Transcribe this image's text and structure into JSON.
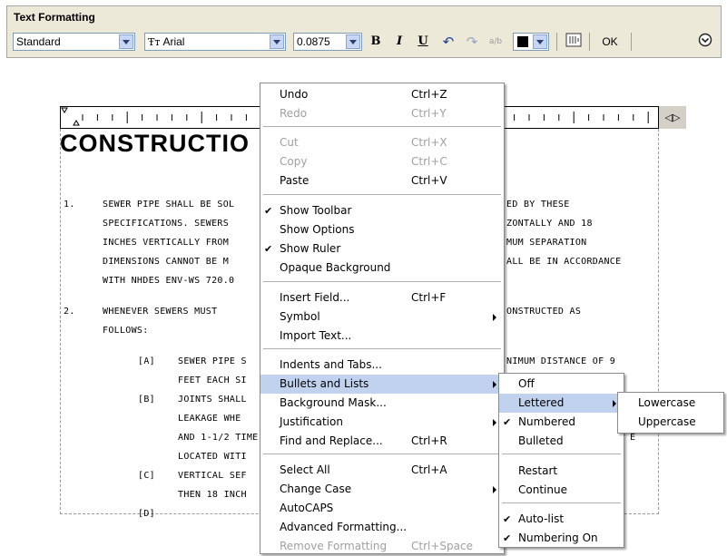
{
  "toolbar": {
    "title": "Text Formatting",
    "style_value": "Standard",
    "font_glyph": "Ŧᴛ",
    "font_value": "Arial",
    "height_value": "0.0875",
    "bold": "B",
    "italic": "I",
    "underline": "U",
    "undo_glyph": "↶",
    "redo_glyph": "↷",
    "stack_glyph": "a/b",
    "ok_label": "OK",
    "options_glyph": "⌄",
    "color_value": "#000000"
  },
  "editor": {
    "heading": "CONSTRUCTIO",
    "lines": [
      {
        "n": "1.",
        "text": "SEWER PIPE SHALL BE SOL"
      },
      {
        "text": "SPECIFICATIONS. SEWERS"
      },
      {
        "text": "INCHES VERTICALLY FROM"
      },
      {
        "text": "DIMENSIONS CANNOT BE M"
      },
      {
        "text": "WITH NHDES ENV-WS 720.0"
      },
      {
        "n": "2.",
        "text": "WHENEVER SEWERS MUST"
      },
      {
        "text": "FOLLOWS:"
      }
    ],
    "right_lines": [
      "ED BY THESE",
      "ZONTALLY AND 18",
      "MUM SEPARATION",
      "ALL BE IN ACCORDANCE",
      "",
      "ONSTRUCTED AS",
      "",
      "NIMUM DISTANCE OF 9",
      "",
      "",
      "",
      "E",
      "",
      ""
    ],
    "subs": [
      {
        "tag": "[A]",
        "text": "SEWER PIPE S"
      },
      {
        "text": "FEET EACH SI"
      },
      {
        "tag": "[B]",
        "text": "JOINTS SHALL"
      },
      {
        "text": "LEAKAGE WHE"
      },
      {
        "text": "AND 1-1/2 TIME"
      },
      {
        "text": "LOCATED WITI"
      },
      {
        "tag": "[C]",
        "text": "VERTICAL SEF"
      },
      {
        "text": "THEN 18 INCH"
      },
      {
        "tag": "[D]",
        "text": ""
      }
    ]
  },
  "context_menu": {
    "items": [
      {
        "label": "Undo",
        "shortcut": "Ctrl+Z"
      },
      {
        "label": "Redo",
        "shortcut": "Ctrl+Y",
        "disabled": true
      },
      {
        "label": "Cut",
        "shortcut": "Ctrl+X",
        "disabled": true
      },
      {
        "label": "Copy",
        "shortcut": "Ctrl+C",
        "disabled": true
      },
      {
        "label": "Paste",
        "shortcut": "Ctrl+V"
      },
      {
        "label": "Show Toolbar",
        "checked": true
      },
      {
        "label": "Show Options"
      },
      {
        "label": "Show Ruler",
        "checked": true
      },
      {
        "label": "Opaque Background"
      },
      {
        "label": "Insert Field...",
        "shortcut": "Ctrl+F"
      },
      {
        "label": "Symbol",
        "submenu": true
      },
      {
        "label": "Import Text..."
      },
      {
        "label": "Indents and Tabs..."
      },
      {
        "label": "Bullets and Lists",
        "submenu": true,
        "highlighted": true
      },
      {
        "label": "Background Mask..."
      },
      {
        "label": "Justification",
        "submenu": true
      },
      {
        "label": "Find and Replace...",
        "shortcut": "Ctrl+R"
      },
      {
        "label": "Select All",
        "shortcut": "Ctrl+A"
      },
      {
        "label": "Change Case",
        "submenu": true
      },
      {
        "label": "AutoCAPS"
      },
      {
        "label": "Advanced Formatting..."
      },
      {
        "label": "Remove Formatting",
        "shortcut": "Ctrl+Space",
        "disabled": true
      }
    ]
  },
  "bullets_menu": {
    "items": [
      {
        "label": "Off"
      },
      {
        "label": "Lettered",
        "submenu": true,
        "highlighted": true
      },
      {
        "label": "Numbered",
        "checked": true
      },
      {
        "label": "Bulleted"
      },
      {
        "label": "Restart"
      },
      {
        "label": "Continue"
      },
      {
        "label": "Auto-list",
        "checked": true
      },
      {
        "label": "Numbering On",
        "checked": true
      }
    ]
  },
  "lettered_menu": {
    "items": [
      {
        "label": "Lowercase"
      },
      {
        "label": "Uppercase"
      }
    ]
  },
  "check_glyph": "✔"
}
